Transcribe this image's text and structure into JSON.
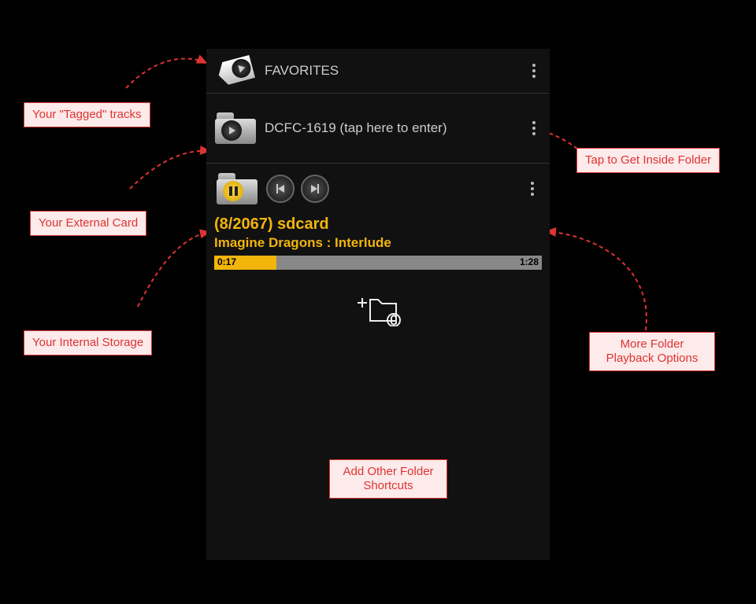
{
  "favorites": {
    "label": "FAVORITES"
  },
  "folder": {
    "label": "DCFC-1619 (tap here to enter)"
  },
  "sdcard": {
    "count_label": "(8/2067)  sdcard",
    "track": "Imagine Dragons : Interlude",
    "elapsed": "0:17",
    "duration": "1:28",
    "progress_pct": 19
  },
  "callouts": {
    "tagged": "Your \"Tagged\" tracks",
    "external": "Your External Card",
    "internal": "Your Internal Storage",
    "inside_folder": "Tap to Get Inside Folder",
    "playback_opts": "More Folder Playback Options",
    "add_shortcuts": "Add Other Folder Shortcuts"
  }
}
